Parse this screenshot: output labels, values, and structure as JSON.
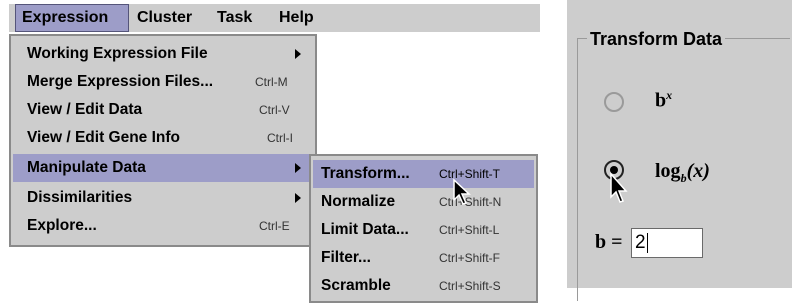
{
  "menubar": {
    "items": [
      {
        "label": "Expression",
        "active": true
      },
      {
        "label": "Cluster"
      },
      {
        "label": "Task"
      },
      {
        "label": "Help"
      }
    ]
  },
  "expression_menu": {
    "items": [
      {
        "label": "Working Expression File",
        "shortcut": "",
        "submenu": true
      },
      {
        "label": "Merge Expression Files...",
        "shortcut": "Ctrl-M"
      },
      {
        "label": "View / Edit Data",
        "shortcut": "Ctrl-V"
      },
      {
        "label": "View / Edit Gene Info",
        "shortcut": "Ctrl-I"
      },
      {
        "label": "Manipulate Data",
        "shortcut": "",
        "submenu": true,
        "highlighted": true
      },
      {
        "label": "Dissimilarities",
        "shortcut": "",
        "submenu": true
      },
      {
        "label": "Explore...",
        "shortcut": "Ctrl-E"
      }
    ]
  },
  "manipulate_submenu": {
    "items": [
      {
        "label": "Transform...",
        "shortcut": "Ctrl+Shift-T",
        "highlighted": true
      },
      {
        "label": "Normalize",
        "shortcut": "Ctrl+Shift-N"
      },
      {
        "label": "Limit Data...",
        "shortcut": "Ctrl+Shift-L"
      },
      {
        "label": "Filter...",
        "shortcut": "Ctrl+Shift-F"
      },
      {
        "label": "Scramble",
        "shortcut": "Ctrl+Shift-S"
      }
    ]
  },
  "transform_panel": {
    "title": "Transform Data",
    "option_power": {
      "base": "b",
      "exp": "x",
      "selected": false
    },
    "option_log": {
      "fn": "log",
      "sub": "b",
      "arg": "(x)",
      "selected": true
    },
    "b_label": "b =",
    "b_value": "2"
  }
}
